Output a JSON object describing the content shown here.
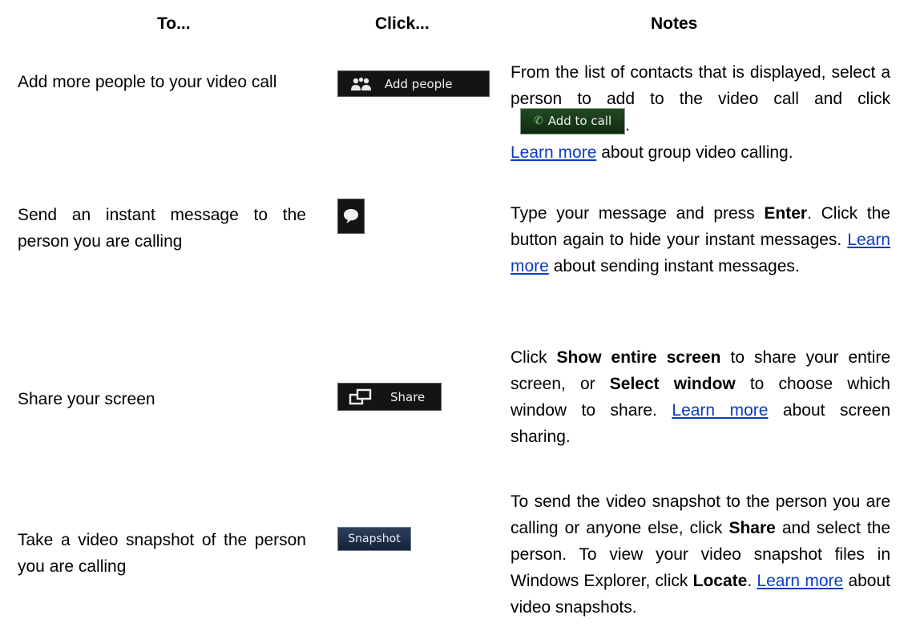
{
  "headers": {
    "to": "To...",
    "click": "Click...",
    "notes": "Notes"
  },
  "rows": [
    {
      "to": "Add more people to your video call",
      "button": "Add people",
      "icon": "add-people-icon",
      "notes": {
        "p1": "From the list of contacts that is displayed, select a person to add to the video call and click",
        "inline_button": "Add to call",
        "p2": ".",
        "link": "Learn more",
        "p3": " about group video calling."
      }
    },
    {
      "to": "Send an instant message to the person you are calling",
      "button": "",
      "icon": "speech-bubble-icon",
      "notes": {
        "p1": "Type your message and press ",
        "b1": "Enter",
        "p2": ". Click the button again to hide your instant messages. ",
        "link": "Learn more",
        "p3": " about sending instant messages."
      }
    },
    {
      "to": "Share your screen",
      "button": "Share",
      "icon": "share-screen-icon",
      "notes": {
        "p1": "Click ",
        "b1": "Show entire screen",
        "p2": " to share your entire screen, or ",
        "b2": "Select window",
        "p3": " to choose which window to share. ",
        "link": "Learn more",
        "p4": " about screen sharing."
      }
    },
    {
      "to": "Take a video snapshot of the person you are calling",
      "button": "Snapshot",
      "notes": {
        "p1": "To send the video snapshot to the person you are calling or anyone else, click ",
        "b1": "Share",
        "p2": " and select the person. To view your video snapshot files in Windows Explorer, click ",
        "b2": "Locate",
        "p3": ". ",
        "link": "Learn more",
        "p4": " about video snapshots."
      }
    }
  ],
  "colors": {
    "link": "#0b3cc1",
    "dark_button": "#141414",
    "call_button": "#1a3d1a",
    "snapshot_button": "#1e2e48"
  }
}
